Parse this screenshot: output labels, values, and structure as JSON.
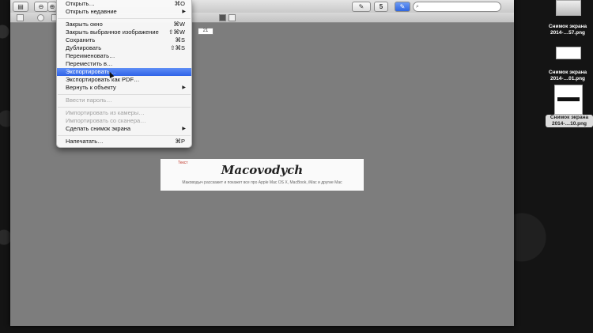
{
  "toolbar": {
    "page_number": "5",
    "page_field": "21",
    "search_placeholder": ""
  },
  "menu": {
    "items": [
      {
        "label": "Открыть…",
        "shortcut": "⌘O"
      },
      {
        "label": "Открыть недавние",
        "arrow": "▶"
      },
      {
        "label": "Закрыть окно",
        "shortcut": "⌘W"
      },
      {
        "label": "Закрыть выбранное изображение",
        "shortcut": "⇧⌘W"
      },
      {
        "label": "Сохранить",
        "shortcut": "⌘S"
      },
      {
        "label": "Дублировать",
        "shortcut": "⇧⌘S"
      },
      {
        "label": "Переименовать…"
      },
      {
        "label": "Переместить в…"
      },
      {
        "label": "Экспортировать…"
      },
      {
        "label": "Экспортировать как PDF…"
      },
      {
        "label": "Вернуть к объекту",
        "arrow": "▶"
      },
      {
        "label": "Ввести пароль…"
      },
      {
        "label": "Импортировать из камеры…"
      },
      {
        "label": "Импортировать со сканера…"
      },
      {
        "label": "Сделать снимок экрана",
        "arrow": "▶"
      },
      {
        "label": "Напечатать…",
        "shortcut": "⌘P"
      }
    ]
  },
  "document": {
    "badge": "Текст",
    "logo": "Macovodych",
    "tagline": "Маководыч расскажет и покажет все про Apple Mac OS X, MacBook, iMac и другие Mac"
  },
  "desktop": {
    "files": [
      {
        "line1": "Снимок экрана",
        "line2": "2014-…57.png",
        "selected": false
      },
      {
        "line1": "Снимок экрана",
        "line2": "2014-…01.png",
        "selected": false
      },
      {
        "line1": "Снимок экрана",
        "line2": "2014-…10.png",
        "selected": true
      }
    ]
  }
}
